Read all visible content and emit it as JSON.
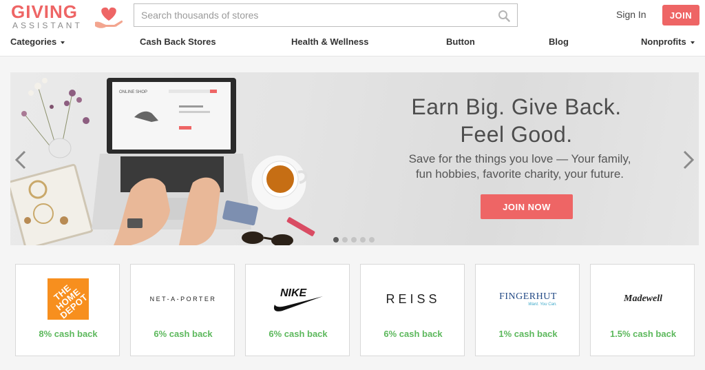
{
  "brand": {
    "line1": "GIVING",
    "line2": "ASSISTANT"
  },
  "search": {
    "placeholder": "Search thousands of stores"
  },
  "auth": {
    "signin": "Sign In",
    "join": "JOIN"
  },
  "nav": [
    {
      "label": "Categories",
      "dropdown": true
    },
    {
      "label": "Cash Back Stores"
    },
    {
      "label": "Health & Wellness"
    },
    {
      "label": "Button"
    },
    {
      "label": "Blog"
    },
    {
      "label": "Nonprofits",
      "dropdown": true
    }
  ],
  "hero": {
    "title_line1": "Earn Big. Give Back.",
    "title_line2": "Feel Good.",
    "subtitle_line1": "Save for the things you love — Your family,",
    "subtitle_line2": "fun hobbies, favorite charity, your future.",
    "cta": "JOIN NOW",
    "slides_total": 5,
    "active_slide": 1,
    "laptop_screen_text": "ONLINE SHOP"
  },
  "stores": [
    {
      "name": "THE HOME DEPOT",
      "cash_back": "8% cash back"
    },
    {
      "name": "NET-A-PORTER",
      "cash_back": "6% cash back"
    },
    {
      "name": "NIKE",
      "cash_back": "6% cash back"
    },
    {
      "name": "REISS",
      "cash_back": "6% cash back"
    },
    {
      "name": "FINGERHUT",
      "tagline": "Want. You Can.",
      "cash_back": "1% cash back"
    },
    {
      "name": "Madewell",
      "cash_back": "1.5% cash back"
    }
  ],
  "colors": {
    "accent": "#ee6565",
    "cashback": "#5cb85c",
    "homedepot": "#f78f1e"
  },
  "icons": {
    "search": "search-icon",
    "prev": "chevron-left-icon",
    "next": "chevron-right-icon",
    "logo": "heart-hand-icon"
  }
}
